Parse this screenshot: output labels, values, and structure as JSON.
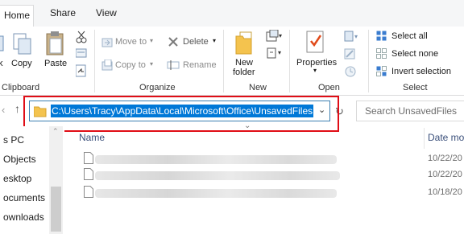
{
  "ribbon": {
    "tabs": [
      {
        "label": "Home",
        "active": true
      },
      {
        "label": "Share",
        "active": false
      },
      {
        "label": "View",
        "active": false
      }
    ],
    "clipboard": {
      "copy_label": "Copy",
      "paste_label": "Paste",
      "group_label": "Clipboard"
    },
    "organize": {
      "move_to_label": "Move to",
      "copy_to_label": "Copy to",
      "delete_label": "Delete",
      "rename_label": "Rename",
      "group_label": "Organize"
    },
    "new": {
      "new_folder_line1": "New",
      "new_folder_line2": "folder",
      "group_label": "New"
    },
    "open": {
      "properties_label": "Properties",
      "group_label": "Open"
    },
    "select": {
      "select_all_label": "Select all",
      "select_none_label": "Select none",
      "invert_selection_label": "Invert selection",
      "group_label": "Select"
    }
  },
  "address": {
    "path": "C:\\Users\\Tracy\\AppData\\Local\\Microsoft\\Office\\UnsavedFiles"
  },
  "search": {
    "placeholder": "Search UnsavedFiles"
  },
  "nav_pane": {
    "items": [
      {
        "label": "s PC"
      },
      {
        "label": "Objects"
      },
      {
        "label": "esktop"
      },
      {
        "label": "ocuments"
      },
      {
        "label": "ownloads"
      }
    ]
  },
  "file_list": {
    "columns": {
      "name": "Name",
      "date": "Date mo"
    },
    "rows": [
      {
        "date": "10/22/20"
      },
      {
        "date": "10/22/20"
      },
      {
        "date": "10/18/20"
      }
    ]
  },
  "colors": {
    "selection": "#0078d7",
    "highlight_box": "#e00d16",
    "folder": "#f4c34e"
  }
}
